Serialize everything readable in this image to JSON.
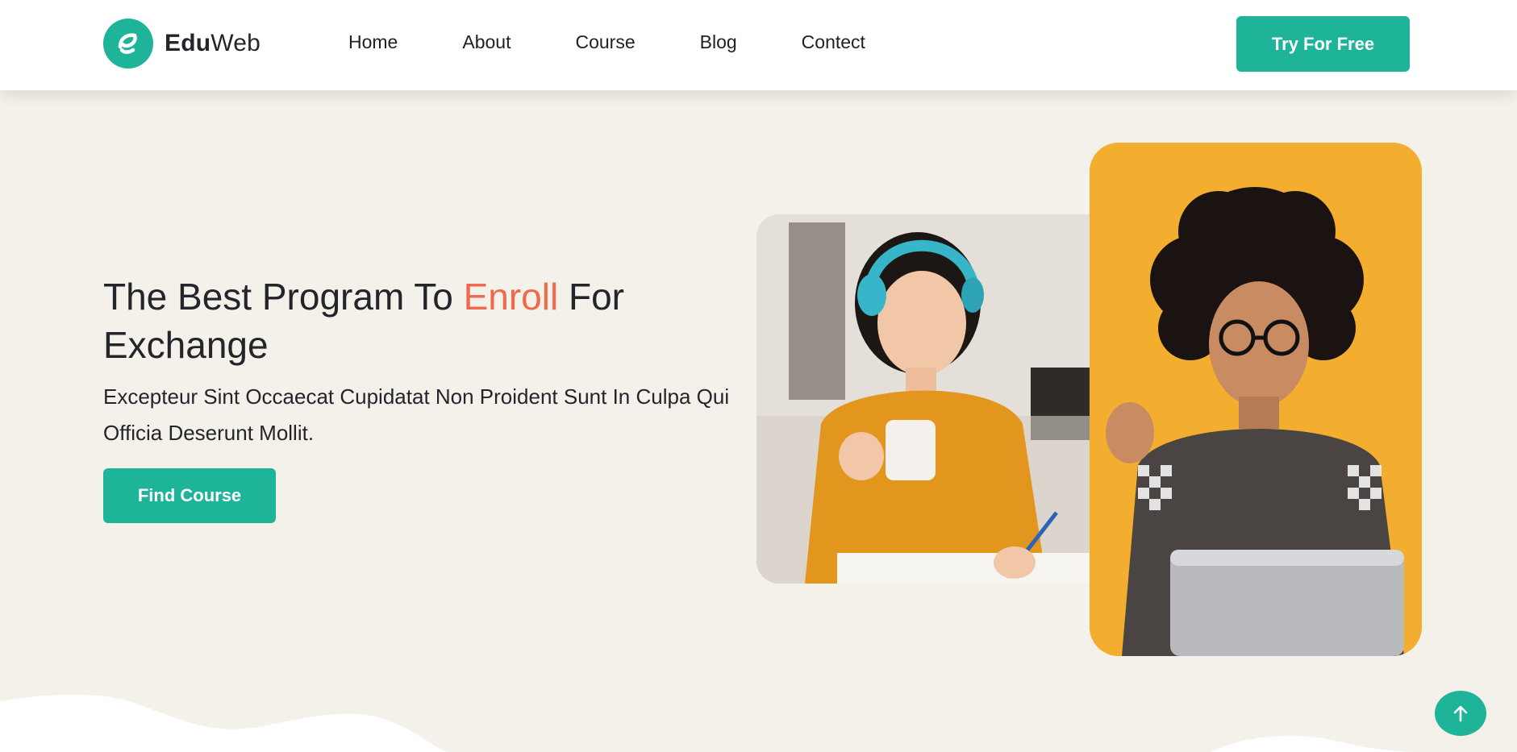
{
  "header": {
    "logo": {
      "bold": "Edu",
      "light": "Web",
      "icon": "leaf-e-logo-icon",
      "color": "#1eb49a"
    },
    "nav": [
      "Home",
      "About",
      "Course",
      "Blog",
      "Contect"
    ],
    "cta_label": "Try For Free"
  },
  "hero": {
    "title_before": "The Best Program To ",
    "title_accent": "Enroll",
    "title_after": " For Exchange",
    "subtitle": "Excepteur Sint Occaecat Cupidatat Non Proident Sunt In Culpa Qui Officia Deserunt Mollit.",
    "button_label": "Find Course",
    "accent_color": "#ef6a4c"
  },
  "images": {
    "left": "student-woman-headphones-photo",
    "right": "student-man-laptop-photo"
  },
  "scroll_top_icon": "arrow-up-icon",
  "colors": {
    "brand": "#1eb49a",
    "background": "#f4f1eb",
    "text": "#24252a"
  }
}
